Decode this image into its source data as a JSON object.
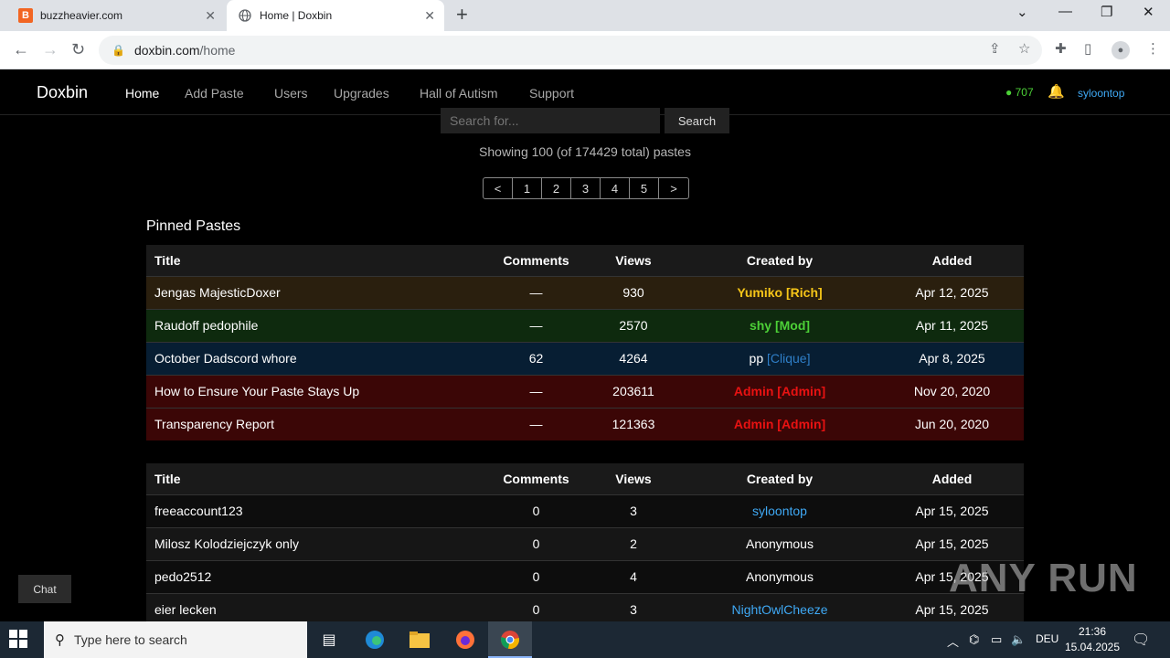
{
  "browser": {
    "tabs": [
      {
        "title": "buzzheavier.com",
        "active": false
      },
      {
        "title": "Home | Doxbin",
        "active": true
      }
    ],
    "url_host": "doxbin.com",
    "url_path": "/home"
  },
  "site": {
    "brand": "Doxbin",
    "nav": [
      "Home",
      "Add Paste",
      "Users",
      "Upgrades",
      "Hall of Autism",
      "Support"
    ],
    "online_count": "707",
    "username": "syloontop"
  },
  "search": {
    "placeholder": "Search for...",
    "button": "Search"
  },
  "showing_text": "Showing 100 (of 174429 total) pastes",
  "pagination": [
    "<",
    "1",
    "2",
    "3",
    "4",
    "5",
    ">"
  ],
  "pinned": {
    "heading": "Pinned Pastes",
    "columns": [
      "Title",
      "Comments",
      "Views",
      "Created by",
      "Added"
    ],
    "rows": [
      {
        "title": "Jengas MajesticDoxer",
        "comments": "—",
        "views": "930",
        "user": "Yumiko",
        "tag": "[Rich]",
        "added": "Apr 12, 2025"
      },
      {
        "title": "Raudoff pedophile",
        "comments": "—",
        "views": "2570",
        "user": "shy",
        "tag": "[Mod]",
        "added": "Apr 11, 2025"
      },
      {
        "title": "October Dadscord whore",
        "comments": "62",
        "views": "4264",
        "user": "pp",
        "tag": "[Clique]",
        "added": "Apr 8, 2025"
      },
      {
        "title": "How to Ensure Your Paste Stays Up",
        "comments": "—",
        "views": "203611",
        "user": "Admin",
        "tag": "[Admin]",
        "added": "Nov 20, 2020"
      },
      {
        "title": "Transparency Report",
        "comments": "—",
        "views": "121363",
        "user": "Admin",
        "tag": "[Admin]",
        "added": "Jun 20, 2020"
      }
    ]
  },
  "recent": {
    "columns": [
      "Title",
      "Comments",
      "Views",
      "Created by",
      "Added"
    ],
    "rows": [
      {
        "title": "freeaccount123",
        "comments": "0",
        "views": "3",
        "user": "syloontop",
        "added": "Apr 15, 2025"
      },
      {
        "title": "Milosz Kolodziejczyk only",
        "comments": "0",
        "views": "2",
        "user": "Anonymous",
        "added": "Apr 15, 2025"
      },
      {
        "title": "pedo2512",
        "comments": "0",
        "views": "4",
        "user": "Anonymous",
        "added": "Apr 15, 2025"
      },
      {
        "title": "eier lecken",
        "comments": "0",
        "views": "3",
        "user": "NightOwlCheeze",
        "added": "Apr 15, 2025"
      }
    ]
  },
  "chat_label": "Chat",
  "watermark": "ANY RUN",
  "taskbar": {
    "search_placeholder": "Type here to search",
    "language": "DEU",
    "time": "21:36",
    "date": "15.04.2025"
  },
  "colors": {
    "rich": "#f5c518",
    "mod": "#4cd137",
    "admin": "#e81212",
    "clique": "#2f7fc8",
    "user_link": "#3fa9f5"
  }
}
